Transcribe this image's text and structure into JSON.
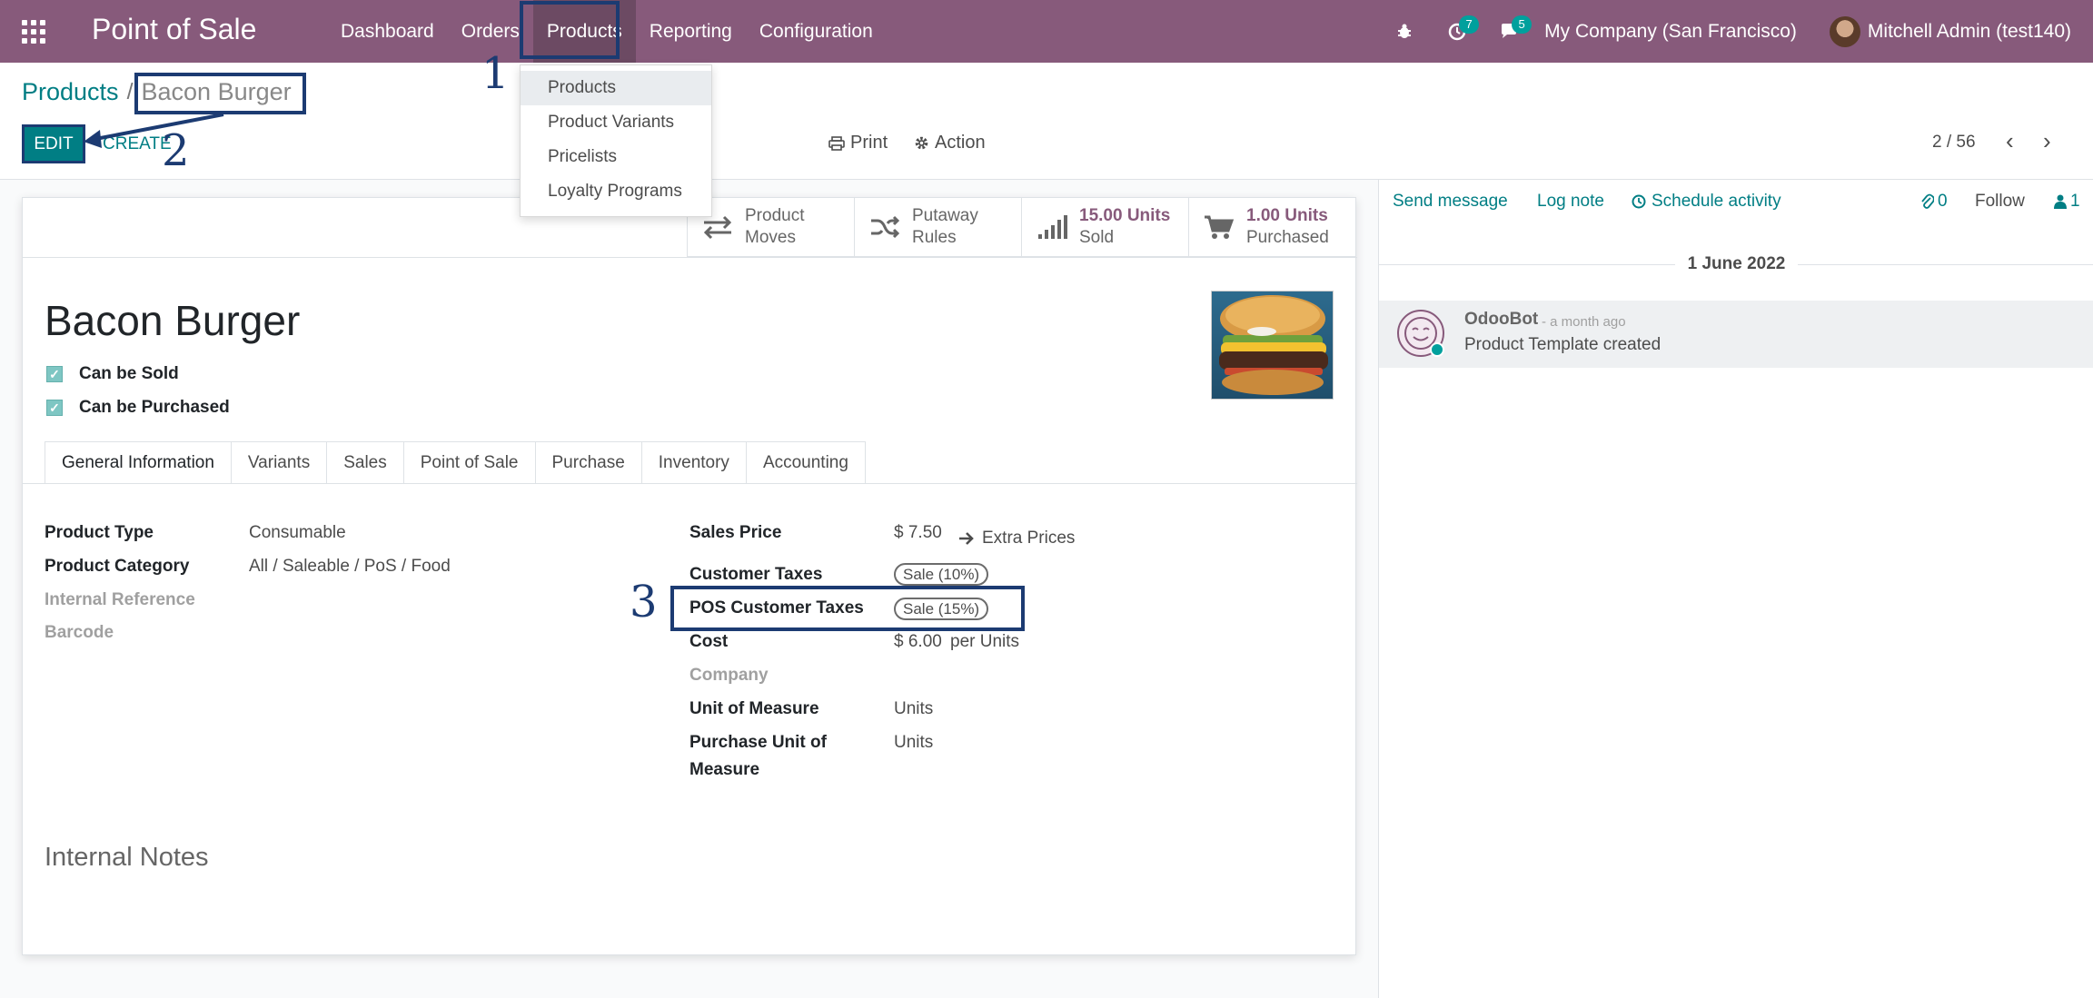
{
  "navbar": {
    "app_title": "Point of Sale",
    "menu": [
      "Dashboard",
      "Orders",
      "Products",
      "Reporting",
      "Configuration"
    ],
    "active_menu": "Products",
    "activity_count": "7",
    "message_count": "5",
    "company": "My Company (San Francisco)",
    "user": "Mitchell Admin (test140)",
    "accent_color": "#875a7b"
  },
  "dropdown": {
    "items": [
      "Products",
      "Product Variants",
      "Pricelists",
      "Loyalty Programs"
    ]
  },
  "control_panel": {
    "breadcrumb_parent": "Products",
    "breadcrumb_sep": "/",
    "breadcrumb_current": "Bacon Burger",
    "edit_label": "EDIT",
    "create_label": "CREATE",
    "print_label": "Print",
    "action_label": "Action",
    "pager": "2 / 56"
  },
  "smart_buttons": [
    {
      "icon": "arrows-exchange-icon",
      "line1": "Product",
      "line2": "Moves"
    },
    {
      "icon": "random-icon",
      "line1": "Putaway",
      "line2": "Rules"
    },
    {
      "icon": "signal-icon",
      "line1": "15.00 Units",
      "line2": "Sold"
    },
    {
      "icon": "cart-icon",
      "line1": "1.00 Units",
      "line2": "Purchased"
    }
  ],
  "product": {
    "name": "Bacon Burger",
    "can_be_sold_label": "Can be Sold",
    "can_be_purchased_label": "Can be Purchased"
  },
  "tabs": [
    "General Information",
    "Variants",
    "Sales",
    "Point of Sale",
    "Purchase",
    "Inventory",
    "Accounting"
  ],
  "general": {
    "product_type_label": "Product Type",
    "product_type": "Consumable",
    "product_category_label": "Product Category",
    "product_category": "All / Saleable / PoS / Food",
    "internal_reference_label": "Internal Reference",
    "barcode_label": "Barcode",
    "sales_price_label": "Sales Price",
    "sales_price": "$ 7.50",
    "extra_prices": "Extra Prices",
    "customer_taxes_label": "Customer Taxes",
    "customer_taxes": "Sale (10%)",
    "pos_taxes_label": "POS Customer Taxes",
    "pos_taxes": "Sale (15%)",
    "cost_label": "Cost",
    "cost": "$ 6.00",
    "cost_unit": "per Units",
    "company_label": "Company",
    "uom_label": "Unit of Measure",
    "uom": "Units",
    "purchase_uom_label_1": "Purchase Unit of",
    "purchase_uom_label_2": "Measure",
    "purchase_uom": "Units",
    "internal_notes": "Internal Notes"
  },
  "chatter": {
    "send_message": "Send message",
    "log_note": "Log note",
    "schedule_activity": "Schedule activity",
    "attachments": "0",
    "follow": "Follow",
    "followers": "1",
    "date": "1 June 2022",
    "author": "OdooBot",
    "time": "- a month ago",
    "body": "Product Template created"
  },
  "annotations": [
    "1",
    "2",
    "3"
  ]
}
